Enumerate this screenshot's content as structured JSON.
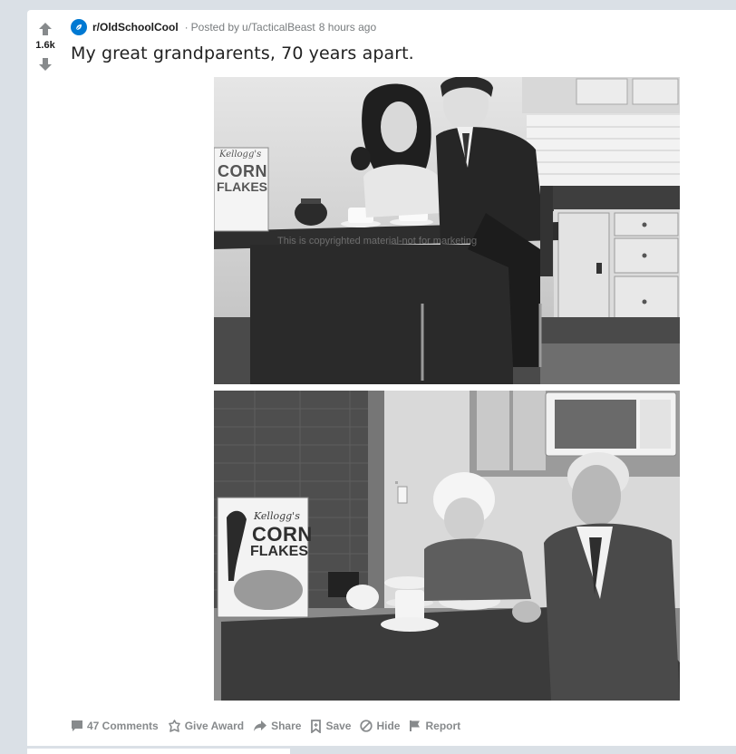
{
  "post": {
    "score": "1.6k",
    "subreddit": "r/OldSchoolCool",
    "separator": "·",
    "posted_by": "Posted by",
    "author": "u/TacticalBeast",
    "time": "8 hours ago",
    "title": "My great grandparents, 70 years apart."
  },
  "images": {
    "top_watermark": "This is copyrighted material-not for marketing",
    "box_brand": "Kellogg's",
    "box_line1": "CORN",
    "box_line2": "FLAKES"
  },
  "actions": {
    "comments": "47 Comments",
    "award": "Give Award",
    "share": "Share",
    "save": "Save",
    "hide": "Hide",
    "report": "Report"
  },
  "colors": {
    "background": "#dae0e6",
    "card": "#ffffff",
    "subreddit_icon": "#0079d3",
    "meta_text": "#787c7e",
    "action_text": "#878a8c"
  }
}
